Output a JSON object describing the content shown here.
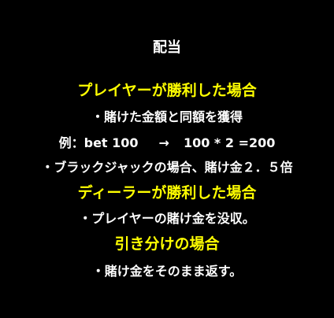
{
  "colors": {
    "background": "#000000",
    "text": "#ffffff",
    "heading": "#ffff00"
  },
  "payout": {
    "title": "配当",
    "player_win": {
      "heading": "プレイヤーが勝利した場合",
      "line1": "・賭けた金額と同額を獲得",
      "example_label": "例：bet 100",
      "example_arrow": "→",
      "example_result": "100 * 2 =200",
      "line2": "・ブラックジャックの場合、賭け金２．５倍"
    },
    "dealer_win": {
      "heading": "ディーラーが勝利した場合",
      "line1": "・プレイヤーの賭け金を没収。"
    },
    "draw": {
      "heading": "引き分けの場合",
      "line1": "・賭け金をそのまま返す。"
    }
  }
}
